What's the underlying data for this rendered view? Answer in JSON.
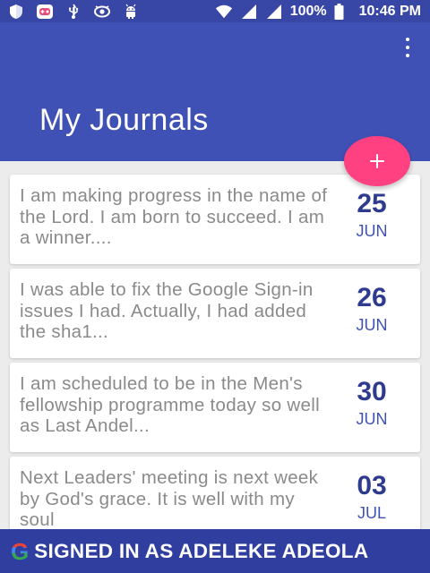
{
  "status_bar": {
    "left_icons": [
      "shield-icon",
      "game-controller-icon",
      "usb-icon",
      "eye-icon",
      "android-icon"
    ],
    "right_icons": [
      "wifi-icon",
      "signal-icon",
      "signal-icon",
      "battery-icon"
    ],
    "battery_text": "100%",
    "time": "10:46 PM"
  },
  "app_bar": {
    "title": "My Journals",
    "menu_icon": "more-vert-icon"
  },
  "fab": {
    "icon": "plus-icon",
    "color": "#ff4081"
  },
  "journals": [
    {
      "text": "I am making progress in the name of the Lord. I am born to succeed.  I am a winner....",
      "day": "25",
      "month": "JUN"
    },
    {
      "text": "I was able to fix the Google Sign-in issues I had. Actually, I had added the sha1...",
      "day": "26",
      "month": "JUN"
    },
    {
      "text": "I am scheduled to be in the Men's fellowship programme today so well as Last Andel...",
      "day": "30",
      "month": "JUN"
    },
    {
      "text": "Next Leaders' meeting is next week by God's grace. It is well with my soul",
      "day": "03",
      "month": "JUL"
    }
  ],
  "signin_banner": {
    "icon": "google-g-icon",
    "g_letter": "G",
    "text": "SIGNED IN AS ADELEKE ADEOLA"
  },
  "colors": {
    "primary": "#3f51b5",
    "primary_dark": "#303f9f",
    "accent": "#ff4081"
  }
}
